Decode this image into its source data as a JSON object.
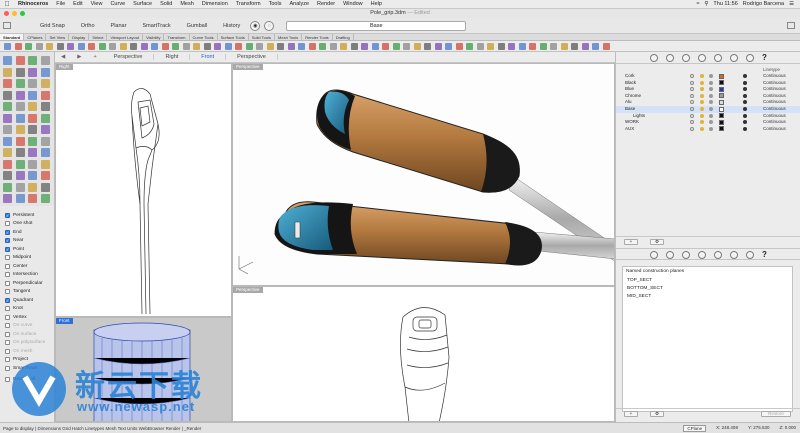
{
  "menubar": {
    "app": "Rhinoceros",
    "items": [
      "File",
      "Edit",
      "View",
      "Curve",
      "Surface",
      "Solid",
      "Mesh",
      "Dimension",
      "Transform",
      "Tools",
      "Analyze",
      "Render",
      "Window",
      "Help"
    ],
    "clock": "Thu 11:56",
    "user": "Rodrigo Barcena"
  },
  "window": {
    "title": "Pole_grip.3dm",
    "edited": "— Edited"
  },
  "toolrow": {
    "toggles": [
      "Grid Snap",
      "Ortho",
      "Planar",
      "SmartTrack",
      "Gumball",
      "History"
    ],
    "layer": "Base"
  },
  "tabs": [
    "Standard",
    "CPlanes",
    "Set View",
    "Display",
    "Select",
    "Viewport Layout",
    "Visibility",
    "Transform",
    "Curve Tools",
    "Surface Tools",
    "Solid Tools",
    "Mesh Tools",
    "Render Tools",
    "Drafting"
  ],
  "viewport_tabs": [
    "Perspective",
    "Right",
    "Front",
    "Perspective"
  ],
  "viewport_active_tab": "Front",
  "viewports": {
    "top_left": "Right",
    "top_right": "Perspective",
    "bottom_left": "Front",
    "bottom_right": "Perspective"
  },
  "osnaps": [
    {
      "label": "Persistent",
      "checked": true,
      "dim": false
    },
    {
      "label": "One shot",
      "checked": false,
      "dim": false
    },
    {
      "label": "End",
      "checked": true,
      "dim": false
    },
    {
      "label": "Near",
      "checked": true,
      "dim": false
    },
    {
      "label": "Point",
      "checked": true,
      "dim": false
    },
    {
      "label": "Midpoint",
      "checked": false,
      "dim": false
    },
    {
      "label": "Center",
      "checked": false,
      "dim": false
    },
    {
      "label": "Intersection",
      "checked": false,
      "dim": false
    },
    {
      "label": "Perpendicular",
      "checked": false,
      "dim": false
    },
    {
      "label": "Tangent",
      "checked": false,
      "dim": false
    },
    {
      "label": "Quadrant",
      "checked": true,
      "dim": false
    },
    {
      "label": "Knot",
      "checked": false,
      "dim": false
    },
    {
      "label": "Vertex",
      "checked": false,
      "dim": false
    },
    {
      "label": "On curve",
      "checked": false,
      "dim": true
    },
    {
      "label": "On surface",
      "checked": false,
      "dim": true
    },
    {
      "label": "On polysurface",
      "checked": false,
      "dim": true
    },
    {
      "label": "On mesh",
      "checked": false,
      "dim": true
    },
    {
      "label": "Project",
      "checked": false,
      "dim": false
    },
    {
      "label": "SmartTrack",
      "checked": false,
      "dim": false
    }
  ],
  "osnap_disable": "Disable all",
  "layers": {
    "col_linetype": "Linetype",
    "rows": [
      {
        "name": "Cork",
        "color": "#d2691e",
        "linetype": "Continuous",
        "indent": false,
        "selected": false
      },
      {
        "name": "Black",
        "color": "#111111",
        "linetype": "Continuous",
        "indent": false,
        "selected": false
      },
      {
        "name": "Blue",
        "color": "#1f3fb0",
        "linetype": "Continuous",
        "indent": false,
        "selected": false
      },
      {
        "name": "Chrome",
        "color": "#9a9a9a",
        "linetype": "Continuous",
        "indent": false,
        "selected": false
      },
      {
        "name": "Alu",
        "color": "#cfe0e8",
        "linetype": "Continuous",
        "indent": false,
        "selected": false
      },
      {
        "name": "Base",
        "color": "#ffffff",
        "linetype": "Continuous",
        "indent": false,
        "selected": true
      },
      {
        "name": "Lights",
        "color": "#111111",
        "linetype": "Continuous",
        "indent": true,
        "selected": false
      },
      {
        "name": "WORK",
        "color": "#111111",
        "linetype": "Continuous",
        "indent": false,
        "selected": false
      },
      {
        "name": "AUX",
        "color": "#111111",
        "linetype": "Continuous",
        "indent": false,
        "selected": false
      }
    ]
  },
  "cplanes": {
    "title": "Named construction planes",
    "items": [
      "TOP_SECT",
      "BOTTOM_SECT",
      "MID_SECT"
    ],
    "restore": "Restore"
  },
  "statusbar": {
    "text": "Page to display | Dimensions Grid Hatch Linetypes Mesh Text Units WebBrowser Render | _Render",
    "cplane": "CPlane",
    "x": "X: 248.408",
    "y": "Y: 275.530",
    "z": "Z: 0.000"
  },
  "watermark": {
    "cn": "新云下载",
    "url": "www.newasp.net"
  },
  "colors": {
    "accent": "#2f6fd6",
    "cork": "#b57a3f",
    "grip_blue": "#2a7ea6"
  }
}
